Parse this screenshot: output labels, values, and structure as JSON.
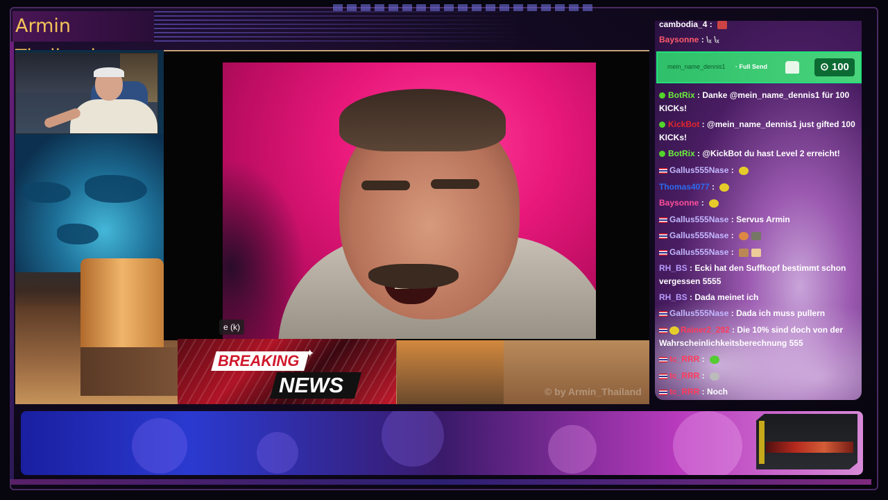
{
  "overlay": {
    "title": "Armin Thailand",
    "video_caption": "e (k)",
    "watermark": "© by Armin_Thailand",
    "breaking_top": "BREAKING",
    "breaking_bottom": "NEWS"
  },
  "gift": {
    "user": "mein_name_dennis1",
    "type": "· Full Send",
    "amount": "100"
  },
  "chat": {
    "messages": [
      {
        "user": "cambodia_4",
        "text": ""
      },
      {
        "user": "Baysonne",
        "text": ""
      },
      {
        "user": "BotRix",
        "text": "Danke @mein_name_dennis1 für 100 KICKs!"
      },
      {
        "user": "KickBot",
        "text": "@mein_name_dennis1 just gifted 100 KICKs!"
      },
      {
        "user": "BotRix",
        "text": "@KickBot du hast Level 2 erreicht!"
      },
      {
        "user": "Gallus555Nase",
        "text": ""
      },
      {
        "user": "Thomas4077",
        "text": ""
      },
      {
        "user": "Baysonne",
        "text": ""
      },
      {
        "user": "Gallus555Nase",
        "text": "Servus Armin"
      },
      {
        "user": "Gallus555Nase",
        "text": ""
      },
      {
        "user": "Gallus555Nase",
        "text": ""
      },
      {
        "user": "RH_BS",
        "text": "Ecki hat den Suffkopf bestimmt schon vergessen 5555"
      },
      {
        "user": "RH_BS",
        "text": "Dada meinet ich"
      },
      {
        "user": "Gallus555Nase",
        "text": "Dada ich muss pullern"
      },
      {
        "user": "Rainer2_292",
        "text": "Die 10% sind doch von der Wahrscheinlichkeitsberechnung 555"
      },
      {
        "user": "tc_RRR",
        "text": ""
      },
      {
        "user": "tc_RRR",
        "text": ""
      },
      {
        "user": "tc_RRR",
        "text": "Noch"
      }
    ]
  },
  "colors": {
    "title_text": "#f5c35a",
    "gift_green": "#2fbf6a",
    "botrix": "#6cf23b",
    "kickbot": "#e2262e"
  }
}
